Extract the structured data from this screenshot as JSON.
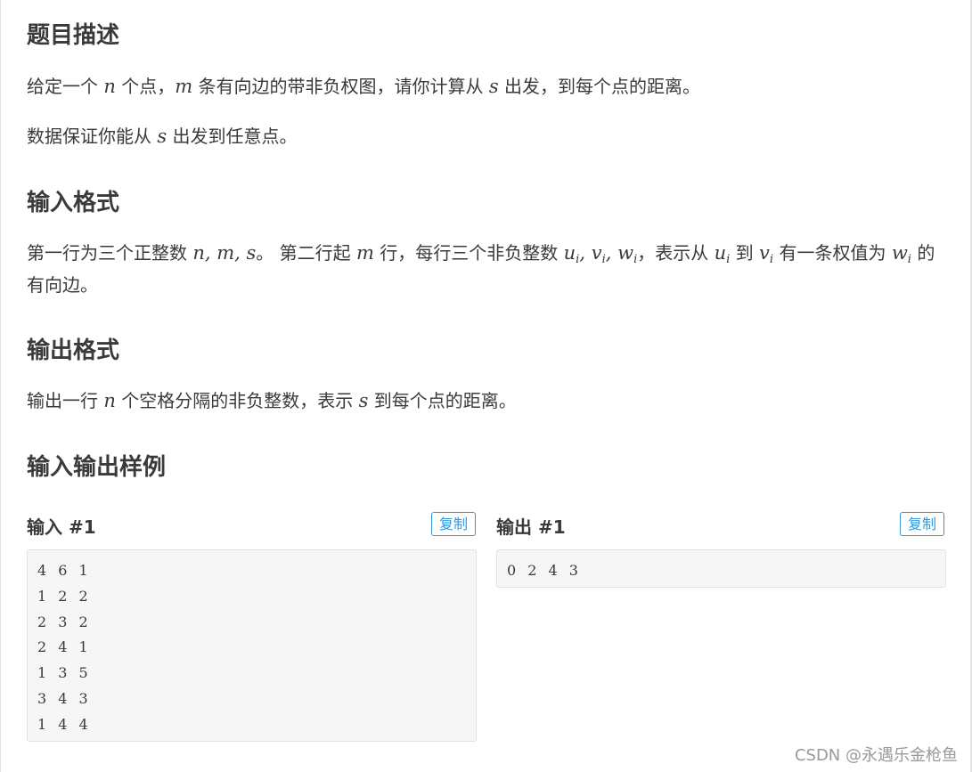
{
  "sections": {
    "description_heading": "题目描述",
    "description_p1": {
      "t1": "给定一个 ",
      "m1": "n",
      "t2": " 个点，",
      "m2": "m",
      "t3": " 条有向边的带非负权图，请你计算从 ",
      "m3": "s",
      "t4": " 出发，到每个点的距离。"
    },
    "description_p2": {
      "t1": "数据保证你能从 ",
      "m1": "s",
      "t2": " 出发到任意点。"
    },
    "input_heading": "输入格式",
    "input_p": {
      "t1": "第一行为三个正整数 ",
      "m1": "n, m, s",
      "t2": "。 第二行起 ",
      "m2": "m",
      "t3": " 行，每行三个非负整数 ",
      "m3_base1": "u",
      "m3_sub1": "i",
      "m3_sep1": ", ",
      "m3_base2": "v",
      "m3_sub2": "i",
      "m3_sep2": ", ",
      "m3_base3": "w",
      "m3_sub3": "i",
      "t4": "，表示从 ",
      "m4_base": "u",
      "m4_sub": "i",
      "t5": " 到 ",
      "m5_base": "v",
      "m5_sub": "i",
      "t6": " 有一条权值为 ",
      "m6_base": "w",
      "m6_sub": "i",
      "t7": " 的有向边。"
    },
    "output_heading": "输出格式",
    "output_p": {
      "t1": "输出一行 ",
      "m1": "n",
      "t2": " 个空格分隔的非负整数，表示 ",
      "m2": "s",
      "t3": " 到每个点的距离。"
    },
    "samples_heading": "输入输出样例"
  },
  "samples": {
    "input_title": "输入 #1",
    "output_title": "输出 #1",
    "copy_label": "复制",
    "input_lines": [
      "4 6 1",
      "1 2 2",
      "2 3 2",
      "2 4 1",
      "1 3 5",
      "3 4 3",
      "1 4 4"
    ],
    "output_lines": [
      "0 2 4 3"
    ]
  },
  "watermark": "CSDN @永遇乐金枪鱼",
  "colors": {
    "text": "#3a3a3a",
    "accent": "#3498db",
    "code_bg": "#f6f6f6",
    "code_border": "#e1e1e1"
  }
}
